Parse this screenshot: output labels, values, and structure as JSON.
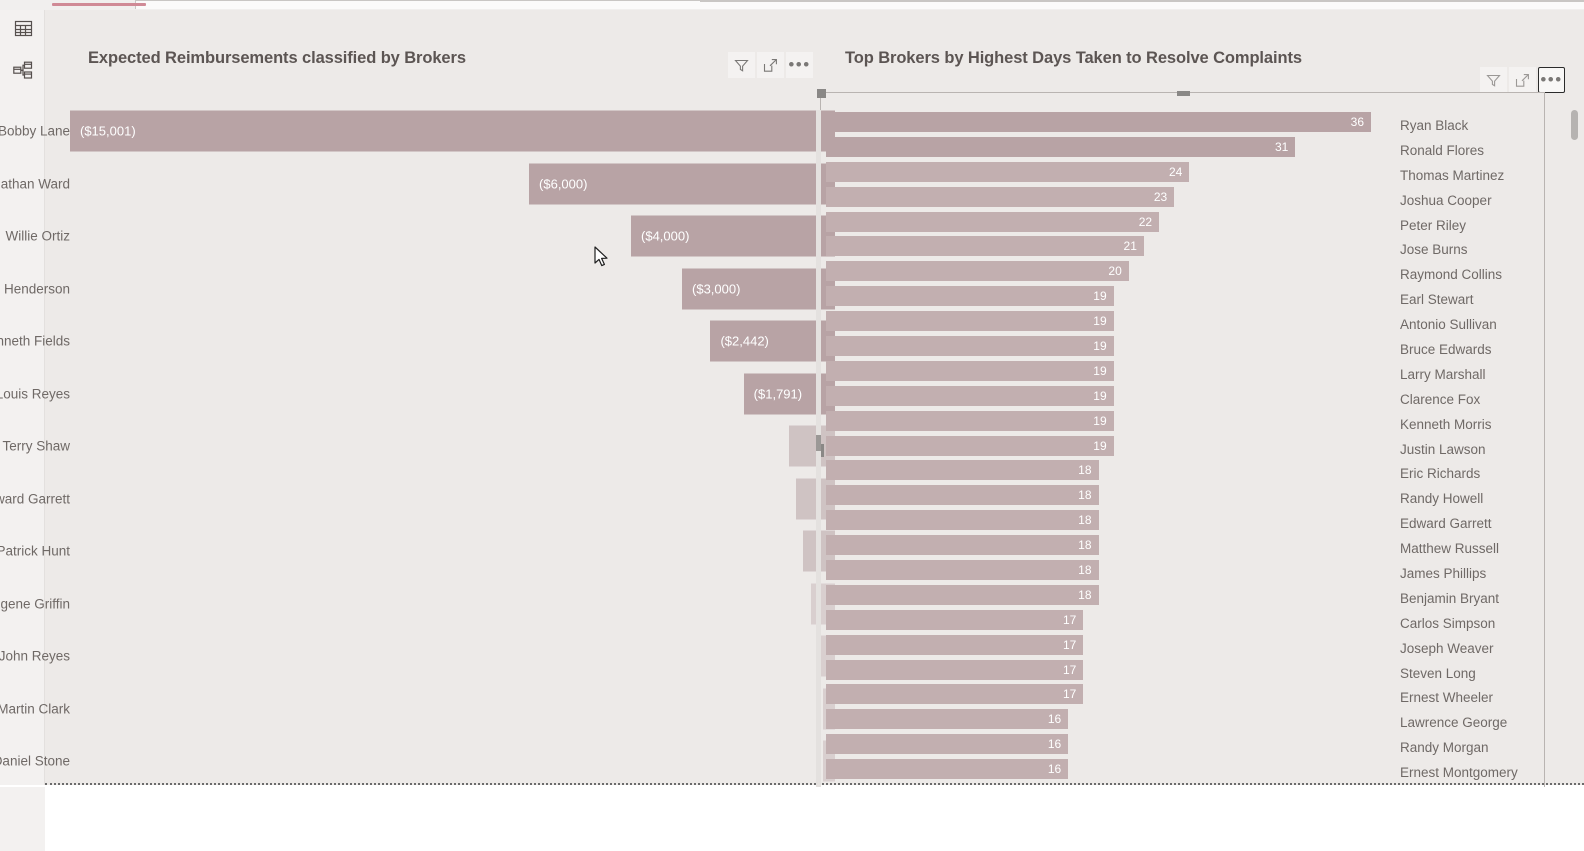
{
  "app": {
    "rail": [
      {
        "name": "table-view-icon",
        "label": "Table view"
      },
      {
        "name": "model-view-icon",
        "label": "Model view"
      }
    ],
    "accent_color": "#d08a96",
    "canvas_bg": "#edeae8",
    "bar_color": "#b8a3a5",
    "bar_color_light": "#c2afb0"
  },
  "visual_left": {
    "title": "Expected Reimbursements classified by Brokers",
    "actions": [
      {
        "name": "filter-icon",
        "label": "Filters"
      },
      {
        "name": "focus-mode-icon",
        "label": "Focus mode"
      },
      {
        "name": "more-options-icon",
        "label": "More options"
      }
    ]
  },
  "visual_right": {
    "title": "Top Brokers by Highest Days Taken to Resolve Complaints",
    "actions": [
      {
        "name": "filter-icon",
        "label": "Filters"
      },
      {
        "name": "focus-mode-icon",
        "label": "Focus mode"
      },
      {
        "name": "more-options-icon",
        "label": "More options"
      }
    ],
    "selected": true
  },
  "chart_data": [
    {
      "type": "bar",
      "orientation": "horizontal",
      "title": "Expected Reimbursements classified by Brokers",
      "xlabel": "",
      "ylabel": "",
      "value_format": "($#,##0)",
      "note": "Negative currency values shown in parentheses; bars grow leftward from a right-side baseline",
      "categories": [
        "Bobby Lane",
        "Jonathan Ward",
        "Willie Ortiz",
        "George Henderson",
        "Kenneth Fields",
        "Louis Reyes",
        "Terry Shaw",
        "Edward Garrett",
        "Patrick Hunt",
        "Eugene Griffin",
        "John Reyes",
        "Martin Clark",
        "Daniel Stone"
      ],
      "values": [
        -15001,
        -6000,
        -4000,
        -3000,
        -2442,
        -1791,
        -900,
        -760,
        -620,
        -470,
        -330,
        -220,
        -120
      ],
      "labels": [
        "($15,001)",
        "($6,000)",
        "($4,000)",
        "($3,000)",
        "($2,442)",
        "($1,791)",
        "",
        "",
        "",
        "",
        "",
        "",
        ""
      ]
    },
    {
      "type": "bar",
      "orientation": "horizontal",
      "title": "Top Brokers by Highest Days Taken to Resolve Complaints",
      "xlabel": "",
      "ylabel": "",
      "categories": [
        "Ryan Black",
        "Ronald Flores",
        "Thomas Martinez",
        "Joshua Cooper",
        "Peter Riley",
        "Jose Burns",
        "Raymond Collins",
        "Earl Stewart",
        "Antonio Sullivan",
        "Bruce Edwards",
        "Larry Marshall",
        "Clarence Fox",
        "Kenneth Morris",
        "Justin Lawson",
        "Eric Richards",
        "Randy Howell",
        "Edward Garrett",
        "Matthew Russell",
        "James Phillips",
        "Benjamin Bryant",
        "Carlos Simpson",
        "Joseph Weaver",
        "Steven Long",
        "Ernest Wheeler",
        "Lawrence George",
        "Randy Morgan",
        "Ernest Montgomery"
      ],
      "values": [
        36,
        31,
        24,
        23,
        22,
        21,
        20,
        19,
        19,
        19,
        19,
        19,
        19,
        19,
        18,
        18,
        18,
        18,
        18,
        18,
        17,
        17,
        17,
        17,
        16,
        16,
        16
      ],
      "xlim": [
        0,
        36
      ]
    }
  ]
}
